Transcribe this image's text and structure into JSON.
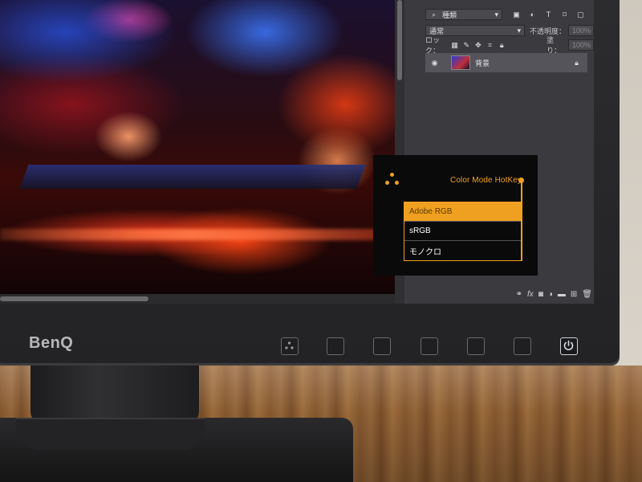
{
  "monitor": {
    "brand": "BenQ"
  },
  "osd": {
    "title": "Color Mode HotKey",
    "options": [
      {
        "label": "Adobe RGB",
        "selected": true
      },
      {
        "label": "sRGB",
        "selected": false
      },
      {
        "label": "モノクロ",
        "selected": false
      }
    ],
    "accent_color": "#f0a020"
  },
  "layers_panel": {
    "filter_kind": "種類",
    "blend_mode": "通常",
    "opacity_label": "不透明度：",
    "opacity_value": "100%",
    "lock_label": "ロック：",
    "fill_label": "塗り：",
    "fill_value": "100%",
    "layer_name": "背景",
    "bottom_icons": [
      "link-icon",
      "fx-icon",
      "mask-icon",
      "adjustment-icon",
      "folder-icon",
      "new-layer-icon",
      "trash-icon"
    ]
  },
  "buttons": [
    "color-mode-hotkey-button",
    "osd-button-2",
    "osd-button-3",
    "osd-button-4",
    "osd-button-5",
    "osd-button-6",
    "power-button"
  ]
}
